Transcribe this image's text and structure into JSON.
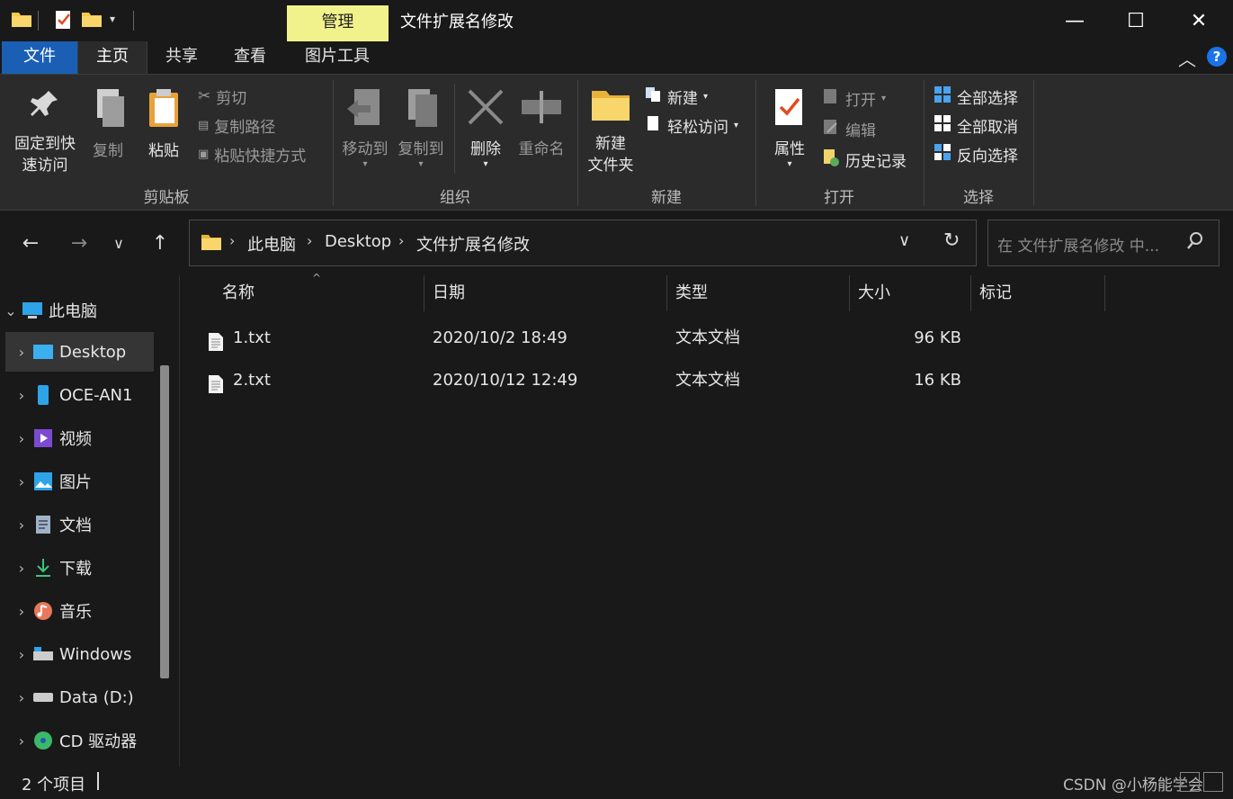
{
  "title_bar": {
    "manage_tab": "管理",
    "window_title": "文件扩展名修改",
    "minimize": "—",
    "maximize": "☐",
    "close": "✕"
  },
  "ribbon_tabs": {
    "file": "文件",
    "home": "主页",
    "share": "共享",
    "view": "查看",
    "picture_tools": "图片工具"
  },
  "ribbon": {
    "clipboard": {
      "label": "剪贴板",
      "pin": [
        "固定到快",
        "速访问"
      ],
      "copy": "复制",
      "paste": "粘贴",
      "cut": "剪切",
      "copy_path": "复制路径",
      "paste_shortcut": "粘贴快捷方式"
    },
    "organize": {
      "label": "组织",
      "move_to": "移动到",
      "copy_to": "复制到",
      "delete": "删除",
      "rename": "重命名"
    },
    "new": {
      "label": "新建",
      "new_folder": [
        "新建",
        "文件夹"
      ],
      "new_item": "新建",
      "easy_access": "轻松访问"
    },
    "open": {
      "label": "打开",
      "properties": "属性",
      "open": "打开",
      "edit": "编辑",
      "history": "历史记录"
    },
    "select": {
      "label": "选择",
      "select_all": "全部选择",
      "select_none": "全部取消",
      "invert": "反向选择"
    }
  },
  "address": {
    "crumbs": [
      "此电脑",
      "Desktop",
      "文件扩展名修改"
    ],
    "search_placeholder": "在 文件扩展名修改 中..."
  },
  "sidebar": {
    "items": [
      {
        "label": "此电脑",
        "icon": "computer-icon"
      },
      {
        "label": "Desktop",
        "icon": "desktop-icon"
      },
      {
        "label": "OCE-AN1",
        "icon": "phone-icon"
      },
      {
        "label": "视频",
        "icon": "video-icon"
      },
      {
        "label": "图片",
        "icon": "pictures-icon"
      },
      {
        "label": "文档",
        "icon": "documents-icon"
      },
      {
        "label": "下载",
        "icon": "download-icon"
      },
      {
        "label": "音乐",
        "icon": "music-icon"
      },
      {
        "label": "Windows",
        "icon": "drive-icon"
      },
      {
        "label": "Data (D:)",
        "icon": "drive-icon"
      },
      {
        "label": "CD 驱动器",
        "icon": "cd-drive-icon"
      }
    ]
  },
  "columns": {
    "name": "名称",
    "date": "日期",
    "type": "类型",
    "size": "大小",
    "tags": "标记"
  },
  "files": [
    {
      "name": "1.txt",
      "date": "2020/10/2 18:49",
      "type": "文本文档",
      "size": "96 KB"
    },
    {
      "name": "2.txt",
      "date": "2020/10/12 12:49",
      "type": "文本文档",
      "size": "16 KB"
    }
  ],
  "status": {
    "count": "2 个项目",
    "watermark": "CSDN @小杨能学会"
  },
  "colors": {
    "accent": "#1a5fb4",
    "manage_tab": "#f2f28c",
    "folder": "#f7c948"
  }
}
